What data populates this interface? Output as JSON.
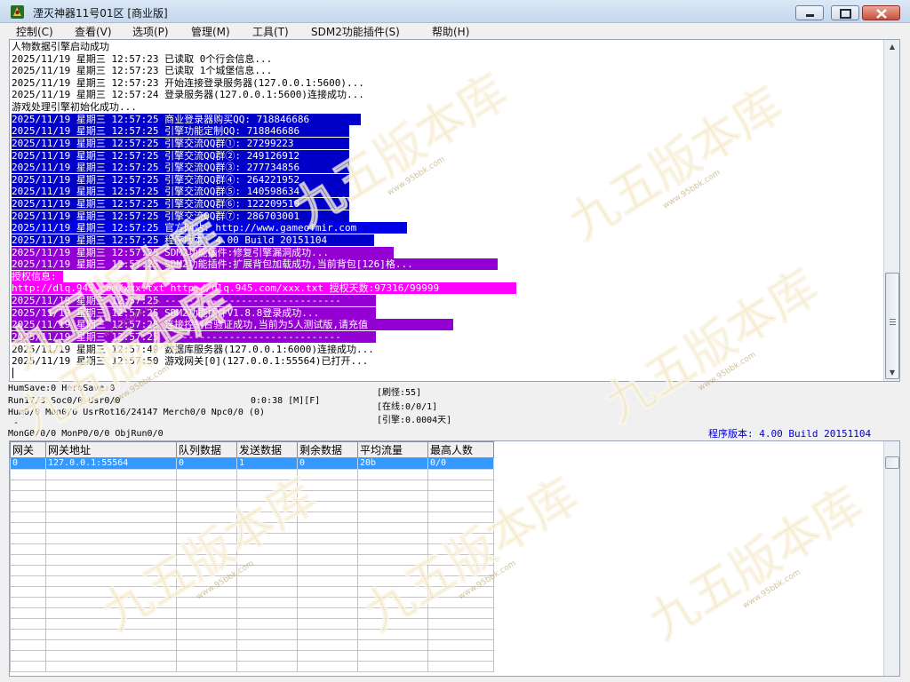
{
  "window": {
    "title": "湮灭神器11号01区 [商业版]",
    "icon": "game-app-icon"
  },
  "menu": [
    "控制(C)",
    "查看(V)",
    "选项(P)",
    "管理(M)",
    "工具(T)",
    "SDM2功能插件(S)",
    "帮助(H)"
  ],
  "colors": {
    "selection_blue": "#0000c8",
    "website_blue": "#0000e6",
    "plugin_purple": "#9400d3",
    "auth_magenta": "#ff00ff",
    "version_text": "#0000cc",
    "row_selected": "#3399ff",
    "watermark_gold": "#e8d08c"
  },
  "log": [
    {
      "text": "人物数据引擎启动成功",
      "style": "plain"
    },
    {
      "text": "2025/11/19 星期三 12:57:23 已读取 0个行会信息...",
      "style": "plain"
    },
    {
      "text": "2025/11/19 星期三 12:57:23 已读取 1个城堡信息...",
      "style": "plain"
    },
    {
      "text": "2025/11/19 星期三 12:57:23 开始连接登录服务器(127.0.0.1:5600)...",
      "style": "plain"
    },
    {
      "text": "2025/11/19 星期三 12:57:24 登录服务器(127.0.0.1:5600)连接成功...",
      "style": "plain"
    },
    {
      "text": "游戏处理引擎初始化成功...",
      "style": "plain"
    },
    {
      "text": "2025/11/19 星期三 12:57:25 商业登录器购买QQ: 718846686",
      "style": "blue"
    },
    {
      "text": "2025/11/19 星期三 12:57:25 引擎功能定制QQ: 718846686",
      "style": "blue"
    },
    {
      "text": "2025/11/19 星期三 12:57:25 引擎交流QQ群①: 27299223",
      "style": "blue"
    },
    {
      "text": "2025/11/19 星期三 12:57:25 引擎交流QQ群②: 249126912",
      "style": "blue"
    },
    {
      "text": "2025/11/19 星期三 12:57:25 引擎交流QQ群③: 277734856",
      "style": "blue"
    },
    {
      "text": "2025/11/19 星期三 12:57:25 引擎交流QQ群④: 264221952",
      "style": "blue"
    },
    {
      "text": "2025/11/19 星期三 12:57:25 引擎交流QQ群⑤: 140598634",
      "style": "blue"
    },
    {
      "text": "2025/11/19 星期三 12:57:25 引擎交流QQ群⑥: 122209510",
      "style": "blue"
    },
    {
      "text": "2025/11/19 星期三 12:57:25 引擎交流QQ群⑦: 286703001",
      "style": "blue"
    },
    {
      "text": "2025/11/19 星期三 12:57:25 官方网站: http://www.gameofmir.com",
      "style": "blue2"
    },
    {
      "text": "2025/11/19 星期三 12:57:25 程序版本: 4.00 Build 20151104",
      "style": "blue"
    },
    {
      "text": "2025/11/19 星期三 12:57:25 SDM2功能插件:修复引擎漏洞成功...",
      "style": "purple"
    },
    {
      "text": "2025/11/19 星期三 12:57:25 SDM2功能插件:扩展背包加载成功,当前背包[126]格...",
      "style": "purple"
    },
    {
      "text": "授权信息:",
      "style": "magenta"
    },
    {
      "text": "http://dlq.945.com/xxx.txt http://dlq.945.com/xxx.txt 授权天数:97316/99999",
      "style": "magenta"
    },
    {
      "text": "2025/11/19 星期三 12:57:25 ------------------------------",
      "style": "purple"
    },
    {
      "text": "2025/11/19 星期三 12:57:25 SDM2功能插件V1.8.8登录成功...",
      "style": "purple"
    },
    {
      "text": "2025/11/19 星期三 12:57:25 连接控制台验证成功,当前为5人测试版,请充值",
      "style": "purple"
    },
    {
      "text": "2025/11/19 星期三 12:57:25 ------------------------------",
      "style": "purple"
    },
    {
      "text": "2025/11/19 星期三 12:57:49 数据库服务器(127.0.0.1:6000)连接成功...",
      "style": "plain"
    },
    {
      "text": "2025/11/19 星期三 12:57:50 游戏网关[0](127.0.0.1:55564)已打开...",
      "style": "plain"
    }
  ],
  "status": {
    "save": "HumSave:0 HeroSave:0",
    "run": "Run17/3 Soc0/0 Usr0/0",
    "time": "0:0:38 [M][F]",
    "hum": "Hum0/0 Mon0/0 UsrRot16/24147 Merch0/0 Npc0/0 (0)",
    "dash": "-",
    "mongen": "MonG0/0/0 MonP0/0/0 ObjRun0/0",
    "refresh": "[刷怪:55]",
    "online": "[在线:0/0/1]",
    "engine": "[引擎:0.0004天]",
    "version": "程序版本: 4.00 Build 20151104"
  },
  "gate_table": {
    "headers": [
      "网关",
      "网关地址",
      "队列数据",
      "发送数据",
      "剩余数据",
      "平均流量",
      "最高人数"
    ],
    "rows": [
      [
        "0",
        "127.0.0.1:55564",
        "0",
        "1",
        "0",
        "20b",
        "0/0"
      ]
    ],
    "empty_rows": 19
  },
  "watermark": {
    "text": "九五版本库",
    "url": "www.95bbk.com"
  }
}
